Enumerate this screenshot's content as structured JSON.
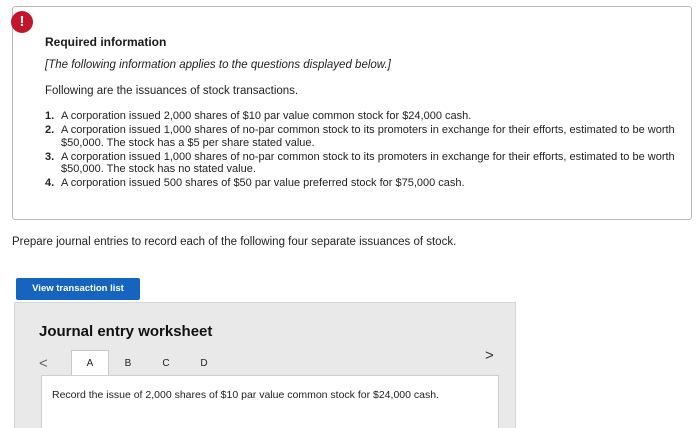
{
  "required_info": {
    "alert_icon": "exclamation-circle-icon",
    "alert_symbol": "!",
    "title": "Required information",
    "note": "[The following information applies to the questions displayed below.]",
    "intro": "Following are the issuances of stock transactions.",
    "items": [
      {
        "num": "1.",
        "text": "A corporation issued 2,000 shares of $10 par value common stock for $24,000 cash."
      },
      {
        "num": "2.",
        "text": "A corporation issued 1,000 shares of no-par common stock to its promoters in exchange for their efforts, estimated to be worth $50,000. The stock has a $5 per share stated value."
      },
      {
        "num": "3.",
        "text": "A corporation issued 1,000 shares of no-par common stock to its promoters in exchange for their efforts, estimated to be worth $50,000. The stock has no stated value."
      },
      {
        "num": "4.",
        "text": "A corporation issued 500 shares of $50 par value preferred stock for $75,000 cash."
      }
    ]
  },
  "prompt": "Prepare journal entries to record each of the following four separate issuances of stock.",
  "view_button": "View transaction list",
  "worksheet": {
    "title": "Journal entry worksheet",
    "prev_symbol": "<",
    "next_symbol": ">",
    "tabs": [
      "A",
      "B",
      "C",
      "D"
    ],
    "active_tab": "A",
    "instruction": "Record the issue of 2,000 shares of $10 par value common stock for $24,000 cash."
  },
  "colors": {
    "alert": "#c4162a",
    "button": "#1565c0",
    "worksheet_bg": "#e9e9e9"
  }
}
